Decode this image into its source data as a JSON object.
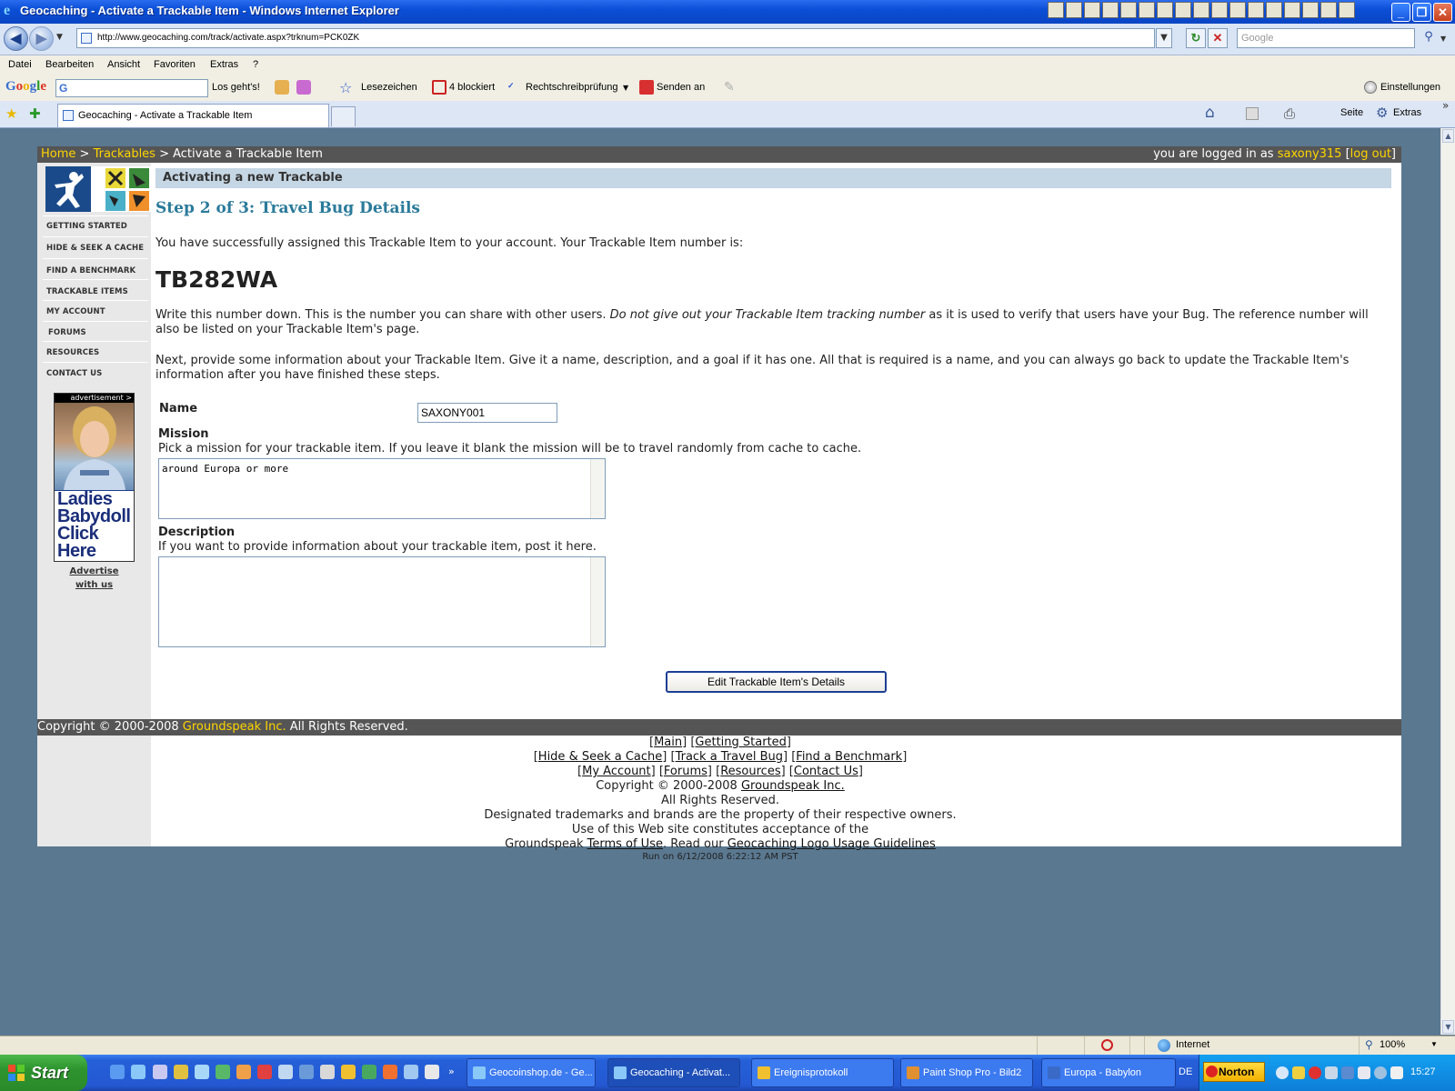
{
  "window": {
    "title": "Geocaching - Activate a Trackable Item - Windows Internet Explorer"
  },
  "address": {
    "url": "http://www.geocaching.com/track/activate.aspx?trknum=PCK0ZK",
    "search_placeholder": "Google"
  },
  "menu": [
    "Datei",
    "Bearbeiten",
    "Ansicht",
    "Favoriten",
    "Extras",
    "?"
  ],
  "google_toolbar": {
    "logo": "Google",
    "search_value": "G",
    "go_label": "Los geht's!",
    "bookmarks_label": "Lesezeichen",
    "blocked_label": "4 blockiert",
    "spellcheck_label": "Rechtschreibprüfung",
    "send_label": "Senden an",
    "settings_label": "Einstellungen"
  },
  "tabs": {
    "active_label": "Geocaching - Activate a Trackable Item",
    "page_label": "Seite",
    "tools_label": "Extras"
  },
  "page": {
    "breadcrumb": {
      "home": "Home",
      "sep1": " > ",
      "trackables": "Trackables",
      "current": " > Activate a Trackable Item",
      "logged_prefix": "you are logged in as ",
      "username": "saxony315",
      "logout_open": " [",
      "logout": "log out",
      "logout_close": "]"
    },
    "sidebar": {
      "items": [
        "GETTING STARTED",
        "HIDE & SEEK A CACHE",
        "FIND A BENCHMARK",
        "TRACKABLE ITEMS",
        "MY ACCOUNT",
        "FORUMS",
        "RESOURCES",
        "CONTACT US"
      ],
      "ad_label": "advertisement >",
      "ad_text": [
        "Ladies",
        "Babydoll",
        "Click",
        "Here"
      ],
      "advertise_link": [
        "Advertise",
        "with us"
      ]
    },
    "header_bar": "Activating a new Trackable",
    "step_title": "Step 2 of 3: Travel Bug Details",
    "assigned_text": "You have successfully assigned this Trackable Item to your account. Your Trackable Item number is:",
    "tb_number": "TB282WA",
    "write_down_1": "Write this number down. This is the number you can share with other users. ",
    "write_down_italic": "Do not give out your Trackable Item tracking number",
    "write_down_2": " as it is used to verify that users have your Bug. The reference number will also be listed on your Trackable Item's page.",
    "next_text": "Next, provide some information about your Trackable Item. Give it a name, description, and a goal if it has one. All that is required is a name, and you can always go back to update the Trackable Item's information after you have finished these steps.",
    "form": {
      "name_label": "Name",
      "name_value": "SAXONY001",
      "mission_label": "Mission",
      "mission_help": "Pick a mission for your trackable item. If you leave it blank the mission will be to travel randomly from cache to cache.",
      "mission_value": "around Europa or more",
      "description_label": "Description",
      "description_help": "If you want to provide information about your trackable item, post it here.",
      "description_value": "",
      "submit_label": "Edit Trackable Item's Details"
    },
    "copyright": {
      "prefix": "Copyright © 2000-2008 ",
      "company": "Groundspeak Inc.",
      "suffix": " All Rights Reserved."
    },
    "footer": {
      "links_row1": [
        "Main",
        "Getting Started"
      ],
      "links_row2": [
        "Hide & Seek a Cache",
        "Track a Travel Bug",
        "Find a Benchmark"
      ],
      "links_row3": [
        "My Account",
        "Forums",
        "Resources",
        "Contact Us"
      ],
      "copyright_prefix": "Copyright © 2000-2008 ",
      "company": "Groundspeak Inc.",
      "rights": "All Rights Reserved.",
      "trademarks": "Designated trademarks and brands are the property of their respective owners.",
      "use_line": "Use of this Web site constitutes acceptance of the",
      "terms_prefix": "Groundspeak ",
      "terms_link": "Terms of Use",
      "read_our": ". Read our ",
      "logo_link": "Geocaching Logo Usage Guidelines",
      "run_on": "Run on 6/12/2008 6:22:12 AM PST"
    }
  },
  "statusbar": {
    "zone": "Internet",
    "zoom": "100%"
  },
  "taskbar": {
    "start": "Start",
    "tasks": [
      "Geocoinshop.de - Ge...",
      "Geocaching - Activat...",
      "Ereignisprotokoll",
      "Paint Shop Pro - Bild2",
      "Europa - Babylon"
    ],
    "norton": "Norton",
    "lang": "DE",
    "clock": "15:27"
  },
  "colors": {
    "title_blue": "#0b4fd6",
    "page_bg": "#5a7890",
    "accent_yellow": "#ffd500",
    "step_teal": "#2a7a9a"
  }
}
